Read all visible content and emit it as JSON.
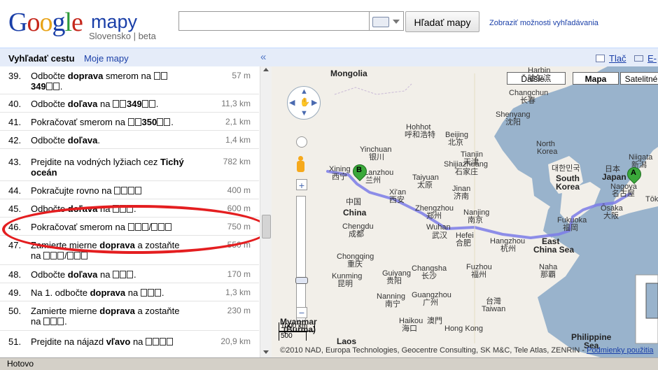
{
  "header": {
    "logo_text": "Google",
    "logo_product": "mapy",
    "logo_sub": "Slovensko | beta",
    "search_value": "",
    "search_button": "Hľadať mapy",
    "advanced_link": "Zobraziť možnosti vyhľadávania"
  },
  "toolbar": {
    "route_tab": "Vyhľadať cestu",
    "my_maps": "Moje mapy",
    "collapse": "«",
    "print": "Tlač",
    "email": "E-"
  },
  "steps": [
    {
      "num": "39.",
      "parts": [
        [
          "Odbočte ",
          0
        ],
        [
          "doprava",
          1
        ],
        [
          " smerom na ",
          0
        ]
      ],
      "code": "349",
      "dist": "57 m"
    },
    {
      "num": "40.",
      "text": "Odbočte doľava na",
      "code": "349",
      "dist": "11,3 km"
    },
    {
      "num": "41.",
      "text": "Pokračovať smerom na",
      "code": "350",
      "dist": "2,1 km"
    },
    {
      "num": "42.",
      "text": "Odbočte doľava.",
      "dist": "1,4 km"
    },
    {
      "num": "43.",
      "text": "Prejdite na vodných lyžiach cez Tichý oceán",
      "dist": "782 km"
    },
    {
      "num": "44.",
      "text": "Pokračujte rovno na",
      "dist": "400 m"
    },
    {
      "num": "45.",
      "text": "Odbočte doľava na",
      "dist": "600 m"
    },
    {
      "num": "46.",
      "text": "Pokračovať smerom na",
      "dist": "750 m"
    },
    {
      "num": "47.",
      "text": "Zamierte mierne doprava a zostaňte na",
      "dist": "550 m"
    },
    {
      "num": "48.",
      "text": "Odbočte doľava na",
      "dist": "170 m"
    },
    {
      "num": "49.",
      "text": "Na 1. odbočte doprava na",
      "dist": "1,3 km"
    },
    {
      "num": "50.",
      "text": "Zamierte mierne doprava a zostaňte na",
      "dist": "230 m"
    },
    {
      "num": "51.",
      "text": "Prejdite na nájazd vľavo na",
      "dist": "20,9 km"
    }
  ],
  "map": {
    "buttons": {
      "more": "Ďalšie...",
      "map": "Mapa",
      "satellite": "Satelitné"
    },
    "labels": {
      "mongolia": "Mongolia",
      "harbin": "Harbin",
      "harbin_cn": "哈尔滨",
      "changchun": "Changchun",
      "changchun_cn": "长春",
      "shenyang": "Shenyang",
      "shenyang_cn": "沈阳",
      "hohhot": "Hohhot",
      "hohhot_cn": "呼和浩特",
      "beijing": "Beijing",
      "beijing_cn": "北京",
      "tianjin": "Tianjin",
      "tianjin_cn": "天津",
      "north_korea": "North",
      "north_korea2": "Korea",
      "seoul_cn": "대한민국",
      "south_korea": "South",
      "south_korea2": "Korea",
      "yinchuan": "Yinchuan",
      "yinchuan_cn": "银川",
      "xining": "Xining",
      "xining_cn": "西宁",
      "lanzhou": "Lanzhou",
      "lanzhou_cn": "兰州",
      "taiyuan": "Taiyuan",
      "taiyuan_cn": "太原",
      "shijiazhuang": "Shijiazhuang",
      "shijiazhuang_cn": "石家庄",
      "jinan": "Jinan",
      "jinan_cn": "济南",
      "xian": "Xi'an",
      "xian_cn": "西安",
      "zhengzhou": "Zhengzhou",
      "zhengzhou_cn": "郑州",
      "nanjing": "Nanjing",
      "nanjing_cn": "南京",
      "china_cn": "中国",
      "china": "China",
      "chengdu": "Chengdu",
      "chengdu_cn": "成都",
      "wuhan": "Wuhan",
      "wuhan_cn": "武汉",
      "hefei": "Hefei",
      "hefei_cn": "合肥",
      "hangzhou": "Hangzhou",
      "hangzhou_cn": "杭州",
      "east_china_sea": "East",
      "east_china_sea2": "China Sea",
      "fukuoka": "Fukuoka",
      "fukuoka_cn": "福岡",
      "osaka": "Ōsaka",
      "osaka_cn": "大阪",
      "nagoya": "Nagoya",
      "nagoya_cn": "名古屋",
      "japan_cn": "日本",
      "japan": "Japan",
      "niigata": "Niigata",
      "niigata_cn": "新潟",
      "tokyo": "Tōkyō",
      "chongqing": "Chongqing",
      "chongqing_cn": "重庆",
      "guiyang": "Guiyang",
      "guiyang_cn": "贵阳",
      "changsha": "Changsha",
      "changsha_cn": "长沙",
      "fuzhou": "Fuzhou",
      "fuzhou_cn": "福州",
      "kunming": "Kunming",
      "kunming_cn": "昆明",
      "nanning": "Nanning",
      "nanning_cn": "南宁",
      "guangzhou": "Guangzhou",
      "guangzhou_cn": "广州",
      "hong_kong": "Hong Kong",
      "macau_cn": "澳門",
      "taiwan_cn": "台灣",
      "taiwan": "Taiwan",
      "naha": "Naha",
      "naha_cn": "那覇",
      "haikou": "Haikou",
      "haikou_cn": "海口",
      "myanmar": "Myanmar",
      "myanmar2": "(Burma)",
      "laos": "Laos",
      "philippine": "Philippine",
      "philippine2": "Sea",
      "kumamoto_cn": "日本"
    },
    "pins": {
      "a": "A",
      "b": "B"
    },
    "scale_km": "1000 km",
    "scale_mi": "500",
    "attribution": "©2010 NAD, Europa Technologies, Geocentre Consulting, SK M&C, Tele Atlas, ZENRIN - ",
    "terms": "Podmienky použitia"
  },
  "status": {
    "text": "Hotovo"
  },
  "colors": {
    "route": "#7b7be8",
    "oval": "#e41e20",
    "land": "#f2efe9",
    "water": "#99b3cc",
    "link": "#1a3fa8"
  }
}
